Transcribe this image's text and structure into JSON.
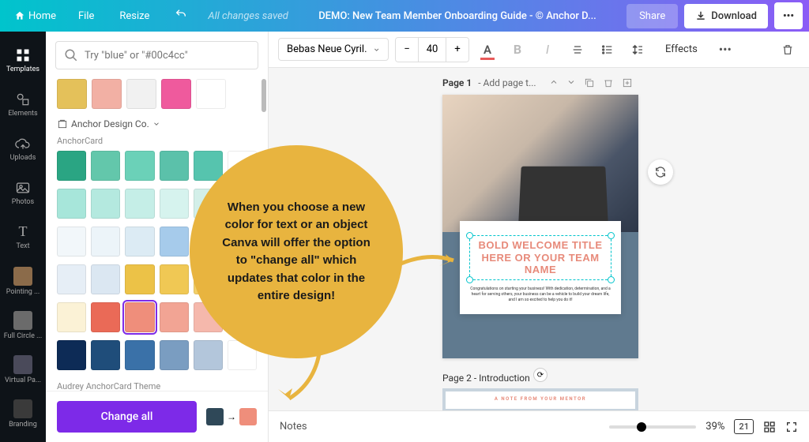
{
  "topbar": {
    "home": "Home",
    "file": "File",
    "resize": "Resize",
    "saved": "All changes saved",
    "title": "DEMO: New Team Member Onboarding Guide - © Anchor D...",
    "share": "Share",
    "download": "Download"
  },
  "rail": {
    "templates": "Templates",
    "elements": "Elements",
    "uploads": "Uploads",
    "photos": "Photos",
    "text": "Text",
    "pointing": "Pointing ...",
    "fullcircle": "Full Circle ...",
    "virtual": "Virtual Pa...",
    "branding": "Branding"
  },
  "side": {
    "search_placeholder": "Try \"blue\" or \"#00c4cc\"",
    "brand_section": "Anchor Design Co.",
    "palette1": "AnchorCard",
    "palette2": "Audrey AnchorCard Theme",
    "change_all": "Change all",
    "from_color": "#2f4858",
    "to_color": "#ef8e7b",
    "row_top": [
      "#e4c15a",
      "#f2b0a4",
      "#f1f1f1",
      "#ef5a9d",
      "#ffffff"
    ],
    "grid": [
      [
        "#2aa583",
        "#63c7ab",
        "#6bd1b8",
        "#5bc1aa",
        "#56c4ae",
        "#ffffff"
      ],
      [
        "#a7e6da",
        "#b4e9df",
        "#c5eee7",
        "#d6f3ee",
        "#d3efe9",
        "#ffffff"
      ],
      [
        "#f2f7fa",
        "#ecf4f9",
        "#dcebf4",
        "#a6cbeb",
        "#8fc0e9",
        "#ffffff"
      ],
      [
        "#e6eef6",
        "#dbe7f2",
        "#ecc247",
        "#f0c854",
        "#f3d06a",
        "#ffffff"
      ],
      [
        "#fbf2d6",
        "#ea6a57",
        "#ef8e7b",
        "#f2a494",
        "#f5b8ac",
        "#ffffff"
      ],
      [
        "#0d2b56",
        "#1f4d7a",
        "#3a71a8",
        "#7a9dc1",
        "#b3c6db",
        "#ffffff"
      ]
    ],
    "selected_index": [
      4,
      2
    ],
    "row_audrey": [
      "#e89ca9",
      "#edb0bb",
      "#f2c5cd",
      "#f7dbe0",
      "#6bd1b8",
      "#ffffff"
    ]
  },
  "toolbar": {
    "font": "Bebas Neue Cyril...",
    "size": "40",
    "effects": "Effects"
  },
  "pages": {
    "p1_label": "Page 1",
    "p1_action": "- Add page t...",
    "card_title_l1": "BOLD WELCOME TITLE",
    "card_title_l2": "HERE OR YOUR TEAM NAME",
    "card_body": "Congratulations on starting your business! With dedication, determination, and a heart for serving others, your business can be a vehicle to build your dream life, and I am so excited to help you do it!",
    "p2_label": "Page 2 - Introduction",
    "mentor": "A NOTE FROM YOUR MENTOR"
  },
  "callout": "When you choose a new color for text or an object Canva will offer the option to \"change all\" which updates that color in the entire design!",
  "bottom": {
    "notes": "Notes",
    "zoom": "39%",
    "pages": "21"
  }
}
